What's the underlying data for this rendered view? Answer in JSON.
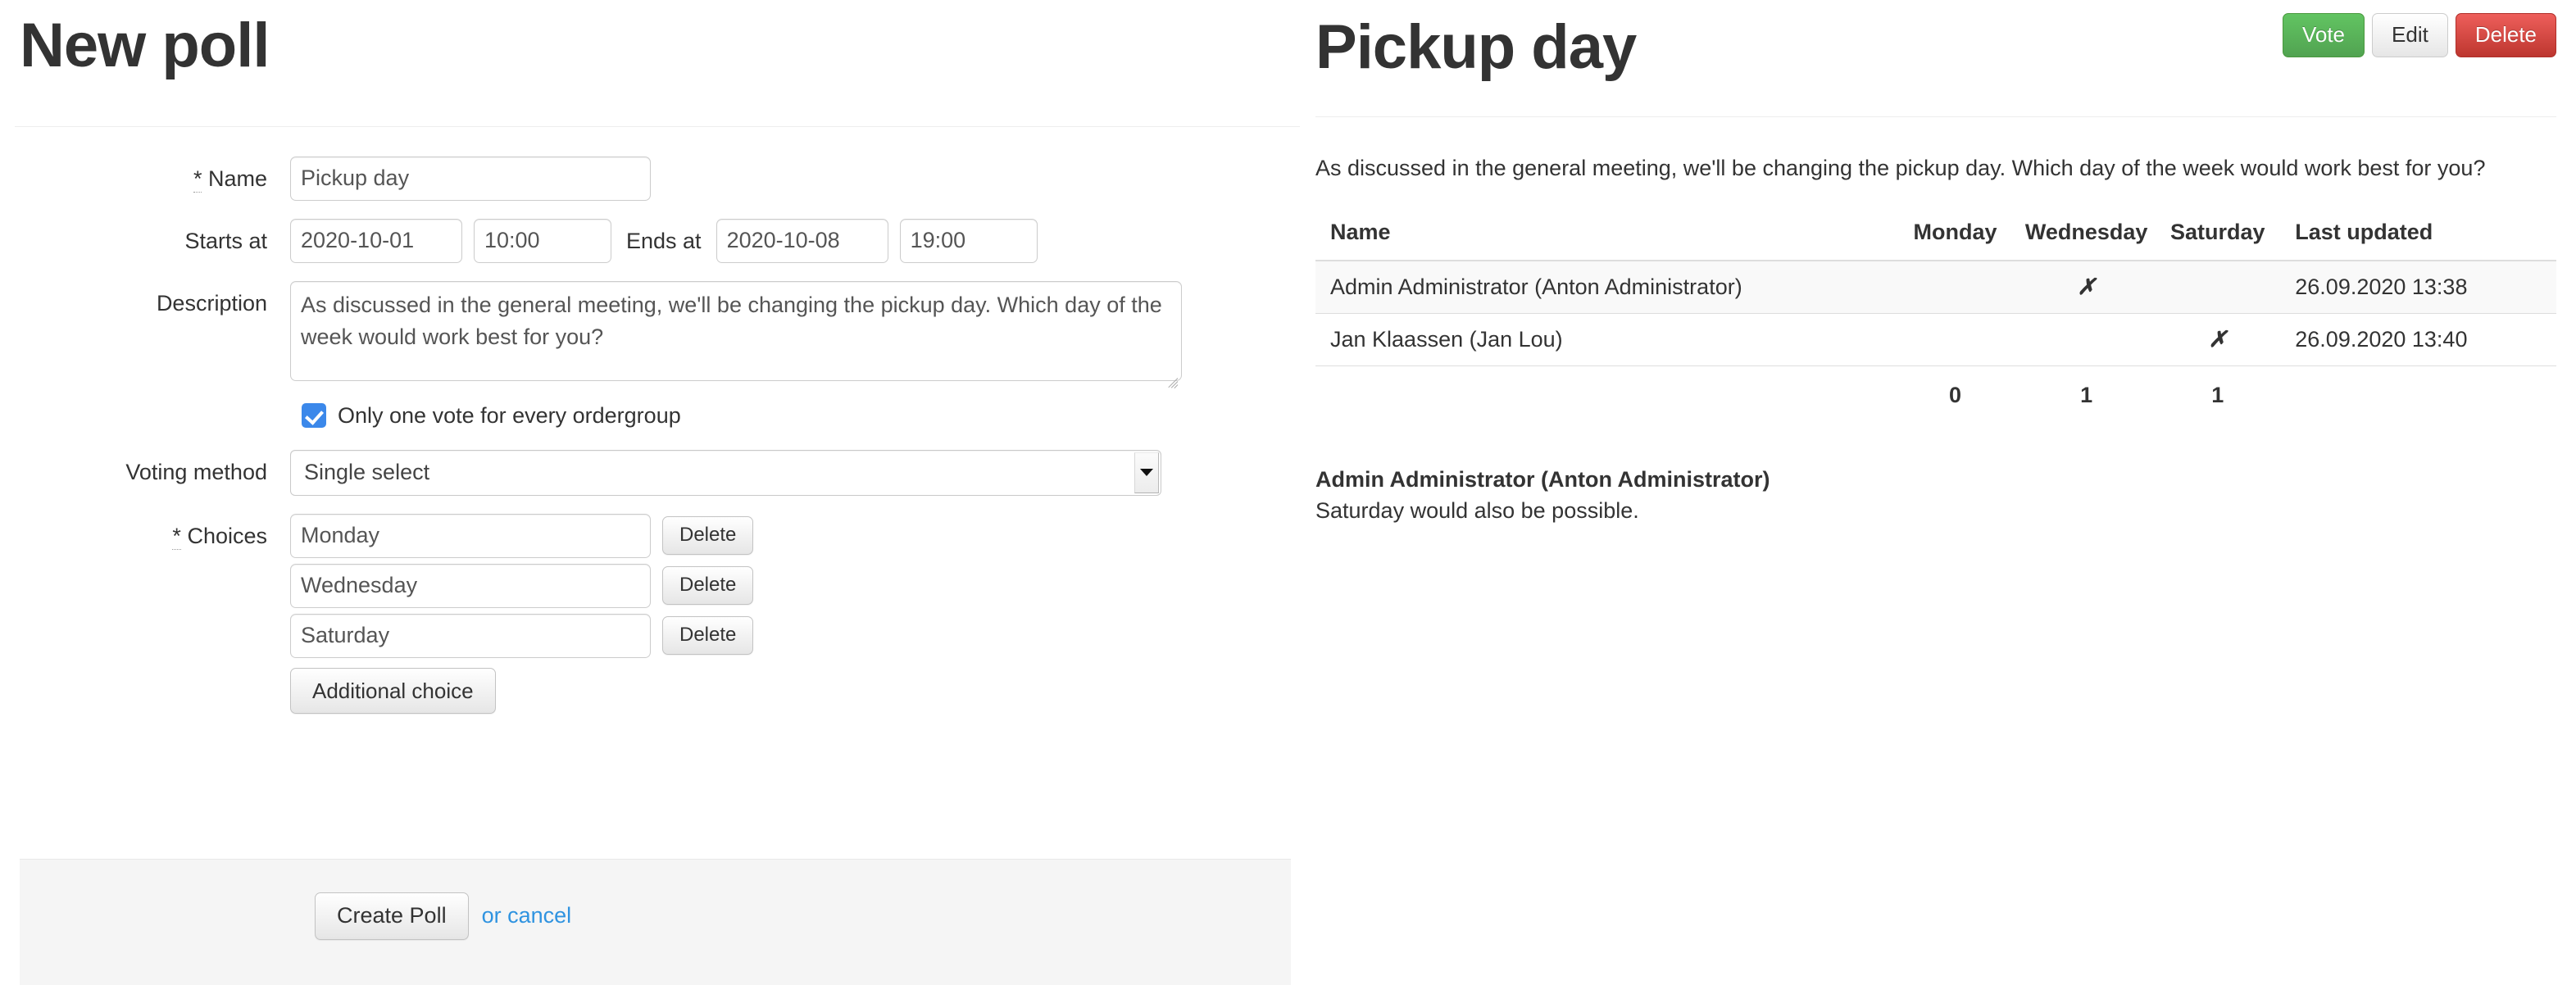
{
  "left_panel": {
    "title": "New poll",
    "form": {
      "name": {
        "label": "Name",
        "required_marker": "*",
        "value": "Pickup day"
      },
      "starts_at": {
        "label": "Starts at",
        "date": "2020-10-01",
        "time": "10:00"
      },
      "ends_at": {
        "label": "Ends at",
        "date": "2020-10-08",
        "time": "19:00"
      },
      "description": {
        "label": "Description",
        "value": "As discussed in the general meeting, we'll be changing the pickup day. Which day of the week would work best for you?"
      },
      "one_vote_checkbox": {
        "label": "Only one vote for every ordergroup",
        "checked": true
      },
      "voting_method": {
        "label": "Voting method",
        "selected": "Single select"
      },
      "choices": {
        "label": "Choices",
        "required_marker": "*",
        "items": [
          {
            "value": "Monday",
            "delete_label": "Delete"
          },
          {
            "value": "Wednesday",
            "delete_label": "Delete"
          },
          {
            "value": "Saturday",
            "delete_label": "Delete"
          }
        ],
        "additional_label": "Additional choice"
      },
      "submit_label": "Create Poll",
      "cancel_label": "or cancel"
    }
  },
  "right_panel": {
    "title": "Pickup day",
    "buttons": {
      "vote": "Vote",
      "edit": "Edit",
      "delete": "Delete"
    },
    "description": "As discussed in the general meeting, we'll be changing the pickup day. Which day of the week would work best for you?",
    "results_table": {
      "headers": [
        "Name",
        "Monday",
        "Wednesday",
        "Saturday",
        "Last updated"
      ],
      "rows": [
        {
          "name": "Admin Administrator (Anton Administrator)",
          "monday": "",
          "wednesday": "✗",
          "saturday": "",
          "last_updated": "26.09.2020 13:38"
        },
        {
          "name": "Jan Klaassen (Jan Lou)",
          "monday": "",
          "wednesday": "",
          "saturday": "✗",
          "last_updated": "26.09.2020 13:40"
        }
      ],
      "totals": {
        "name": "",
        "monday": "0",
        "wednesday": "1",
        "saturday": "1",
        "last_updated": ""
      }
    },
    "comment": {
      "author": "Admin Administrator (Anton Administrator)",
      "text": "Saturday would also be possible."
    }
  },
  "colors": {
    "vote_green": "#51a351",
    "delete_red": "#bd362f",
    "link_blue": "#2f93e0",
    "checkbox_blue": "#3b88ea",
    "text": "#333333"
  }
}
